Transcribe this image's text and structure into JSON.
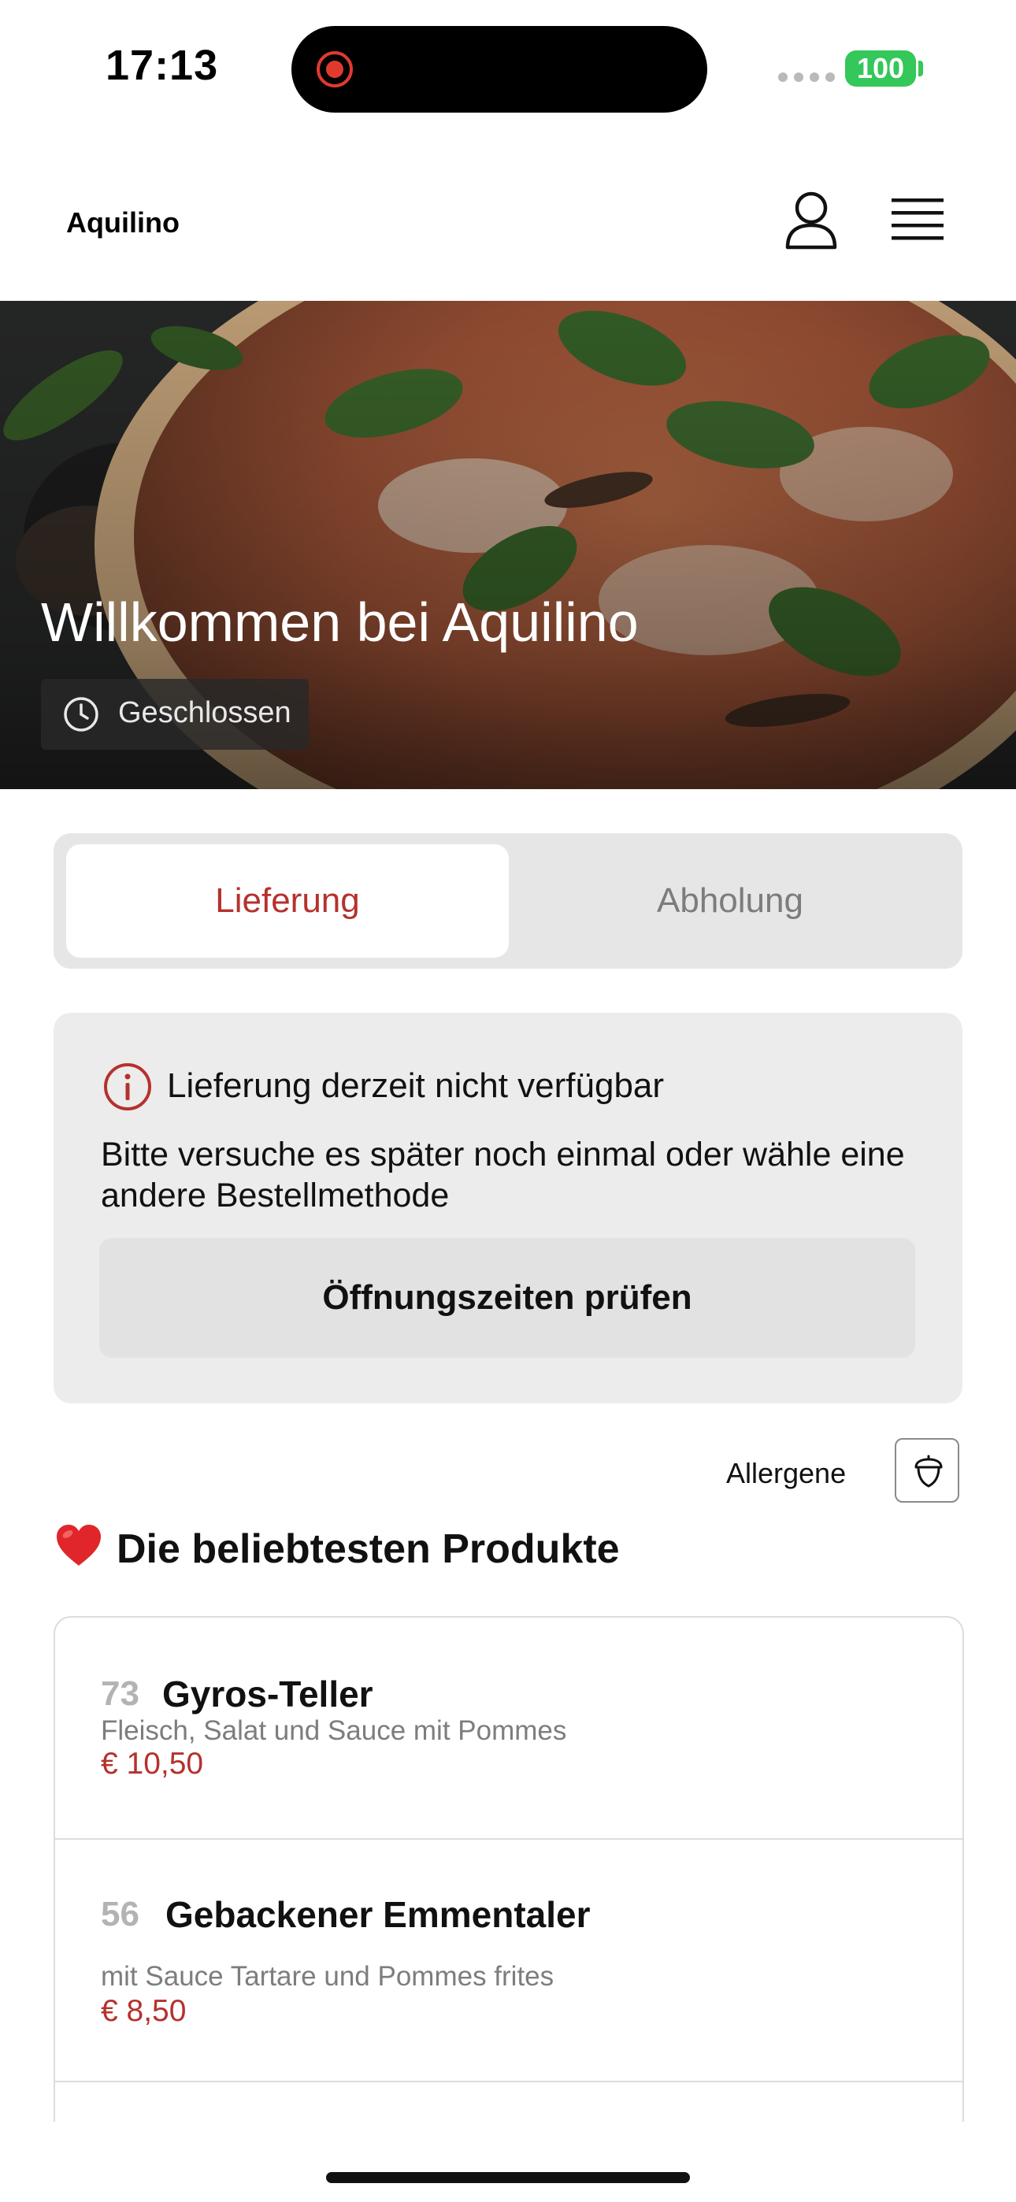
{
  "status_bar": {
    "time": "17:13",
    "battery": "100"
  },
  "header": {
    "brand": "Aquilino"
  },
  "hero": {
    "title": "Willkommen bei Aquilino",
    "status": "Geschlossen"
  },
  "order_mode": {
    "delivery": "Lieferung",
    "pickup": "Abholung",
    "selected": "Lieferung"
  },
  "notice": {
    "title": "Lieferung derzeit nicht verfügbar",
    "body": "Bitte versuche es später noch einmal oder wähle eine andere Bestellmethode",
    "button": "Öffnungszeiten prüfen"
  },
  "allergens": {
    "label": "Allergene"
  },
  "popular": {
    "title": "Die beliebtesten Produkte",
    "products": [
      {
        "number": "73",
        "name": "Gyros-Teller",
        "description": "Fleisch, Salat und Sauce mit Pommes",
        "price": "€ 10,50"
      },
      {
        "number": "56",
        "name": "Gebackener Emmentaler",
        "description": "mit Sauce Tartare und Pommes frites",
        "price": "€ 8,50"
      }
    ]
  },
  "colors": {
    "accent": "#b5312d",
    "battery": "#34c759",
    "record": "#e03a2f"
  },
  "icons": [
    "record-icon",
    "user-icon",
    "menu-icon",
    "clock-icon",
    "info-icon",
    "acorn-icon",
    "heart-icon"
  ]
}
